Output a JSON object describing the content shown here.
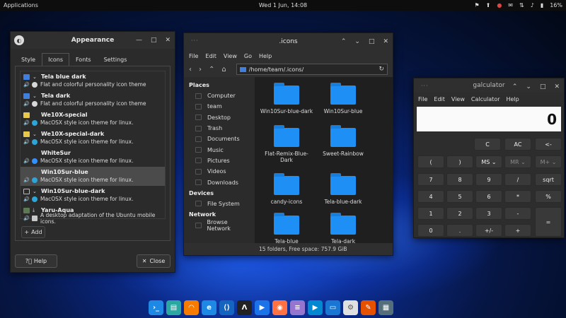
{
  "topbar": {
    "applications": "Applications",
    "clock": "Wed  1 Jun, 14:08",
    "battery": "16%"
  },
  "appearance": {
    "title": "Appearance",
    "tabs": [
      "Style",
      "Icons",
      "Fonts",
      "Settings"
    ],
    "themes": [
      {
        "name": "Tela blue dark",
        "desc": "Flat and colorful personality icon theme"
      },
      {
        "name": "Tela dark",
        "desc": "Flat and colorful personality icon theme"
      },
      {
        "name": "We10X-special",
        "desc": "MacOSX style icon theme for linux."
      },
      {
        "name": "We10X-special-dark",
        "desc": "MacOSX style icon theme for linux."
      },
      {
        "name": "WhiteSur",
        "desc": "MacOSX style icon theme for linux."
      },
      {
        "name": "Win10Sur-blue",
        "desc": "MacOSX style icon theme for linux."
      },
      {
        "name": "Win10Sur-blue-dark",
        "desc": "MacOSX style icon theme for linux."
      },
      {
        "name": "Yaru-Aqua",
        "desc": "A desktop adaptation of the Ubuntu mobile icons."
      }
    ],
    "add_label": "Add",
    "help_label": "Help",
    "close_label": "Close"
  },
  "files": {
    "title": ".icons",
    "menu": [
      "File",
      "Edit",
      "View",
      "Go",
      "Help"
    ],
    "path": "/home/team/.icons/",
    "places_header": "Places",
    "places": [
      "Computer",
      "team",
      "Desktop",
      "Trash",
      "Documents",
      "Music",
      "Pictures",
      "Videos",
      "Downloads"
    ],
    "devices_header": "Devices",
    "devices": [
      "File System"
    ],
    "network_header": "Network",
    "network": [
      "Browse Network"
    ],
    "items": [
      "Win10Sur-blue-dark",
      "Win10Sur-blue",
      "Flat-Remix-Blue-Dark",
      "Sweet-Rainbow",
      "candy-icons",
      "Tela-blue-dark",
      "Tela-blue",
      "Tela-dark"
    ],
    "status": "15 folders, Free space: 757.9 GiB"
  },
  "calc": {
    "title": "galculator",
    "menu": [
      "File",
      "Edit",
      "View",
      "Calculator",
      "Help"
    ],
    "display": "0",
    "keys": [
      [
        "",
        "",
        "C",
        "AC",
        "<-"
      ],
      [
        "(",
        ")",
        "MS",
        "MR",
        "M+"
      ],
      [
        "7",
        "8",
        "9",
        "/",
        "sqrt"
      ],
      [
        "4",
        "5",
        "6",
        "*",
        "%"
      ],
      [
        "1",
        "2",
        "3",
        "-",
        "="
      ],
      [
        "0",
        ".",
        "+/-",
        "+",
        ""
      ]
    ]
  },
  "dock_apps": [
    "terminal",
    "files",
    "headphones",
    "edge",
    "vscode",
    "inkscape",
    "kdenlive",
    "firefox",
    "document-viewer",
    "video",
    "folder",
    "settings",
    "kite",
    "calculator"
  ]
}
